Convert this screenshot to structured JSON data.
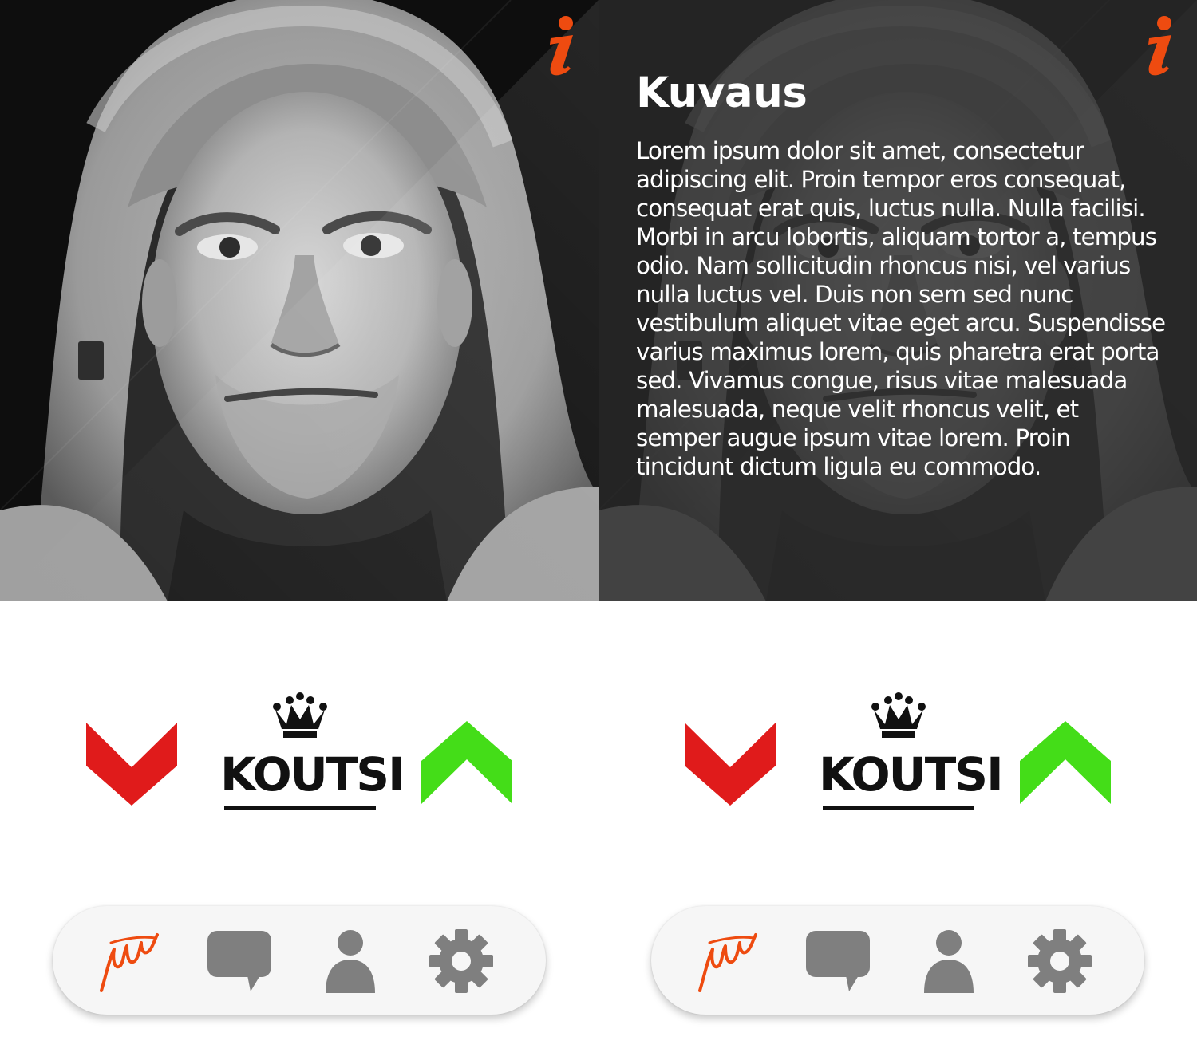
{
  "screens": [
    {
      "id": "photo-view",
      "header": {
        "info_icon": "info-icon"
      },
      "photo": {
        "subject": "portrait-photo"
      },
      "vote": {
        "down_icon": "chevron-down-icon",
        "up_icon": "chevron-up-icon",
        "label": "KOUTSI",
        "badge_icon": "crown-icon"
      },
      "tabs": [
        {
          "name": "logo",
          "icon": "signature-logo-icon"
        },
        {
          "name": "chat",
          "icon": "chat-bubble-icon"
        },
        {
          "name": "profile",
          "icon": "person-icon"
        },
        {
          "name": "settings",
          "icon": "gear-icon"
        }
      ]
    },
    {
      "id": "description-view",
      "header": {
        "info_icon": "info-icon"
      },
      "description": {
        "title": "Kuvaus",
        "body": "Lorem ipsum dolor sit amet, consectetur adipiscing elit. Proin tempor eros consequat, consequat erat quis, luctus nulla. Nulla facilisi. Morbi in arcu lobortis, aliquam tortor a, tempus odio. Nam sollicitudin rhoncus nisi, vel varius nulla luctus vel. Duis non sem sed nunc vestibulum aliquet vitae eget arcu. Suspendisse varius maximus lorem, quis pharetra erat porta sed. Vivamus congue, risus vitae malesuada malesuada, neque velit rhoncus velit, et semper augue ipsum vitae lorem. Proin tincidunt dictum ligula eu commodo."
      },
      "vote": {
        "down_icon": "chevron-down-icon",
        "up_icon": "chevron-up-icon",
        "label": "KOUTSI",
        "badge_icon": "crown-icon"
      },
      "tabs": [
        {
          "name": "logo",
          "icon": "signature-logo-icon"
        },
        {
          "name": "chat",
          "icon": "chat-bubble-icon"
        },
        {
          "name": "profile",
          "icon": "person-icon"
        },
        {
          "name": "settings",
          "icon": "gear-icon"
        }
      ]
    }
  ],
  "colors": {
    "accent": "#ee4b10",
    "downvote": "#e01b1b",
    "upvote": "#44dd18",
    "tab_icon": "#7f7f7f",
    "overlay": "#2a2a2a",
    "tabbar_bg": "#f6f6f6"
  }
}
